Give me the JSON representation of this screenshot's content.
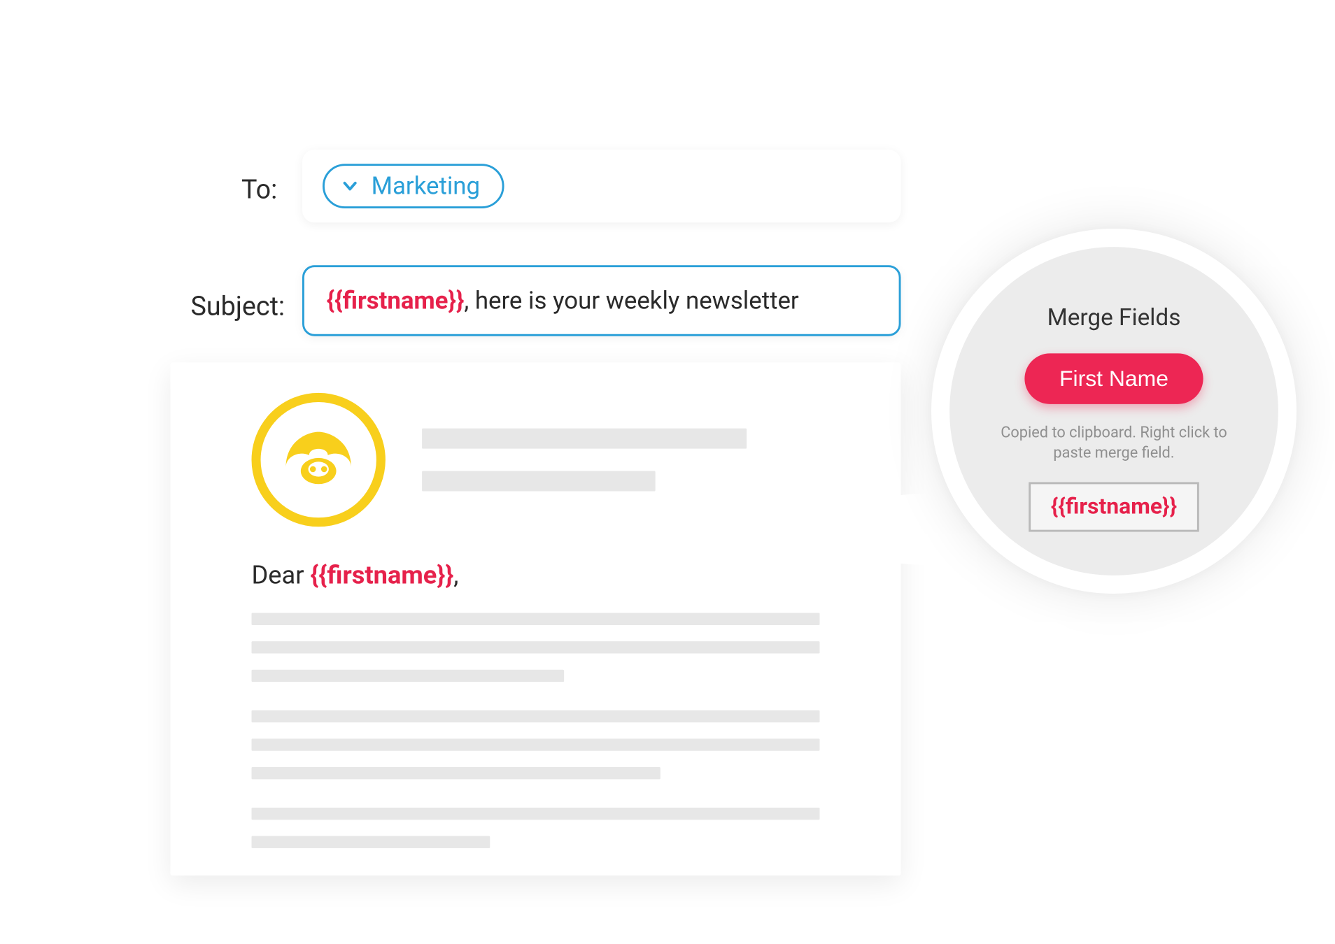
{
  "labels": {
    "to": "To:",
    "subject": "Subject:"
  },
  "to": {
    "chip_label": "Marketing"
  },
  "subject": {
    "token": "{{firstname}}",
    "rest": ", here is your weekly newsletter"
  },
  "email": {
    "salutation_prefix": "Dear ",
    "salutation_token": "{{firstname}}",
    "salutation_suffix": ","
  },
  "callout": {
    "title": "Merge Fields",
    "button": "First Name",
    "hint": "Copied to clipboard. Right click to paste merge field.",
    "code": "{{firstname}}"
  },
  "colors": {
    "accent_blue": "#2a9fd8",
    "accent_red": "#ed2654",
    "token_red": "#e6214b",
    "avatar_yellow": "#f8cf1c",
    "placeholder_gray": "#e7e7e7"
  }
}
